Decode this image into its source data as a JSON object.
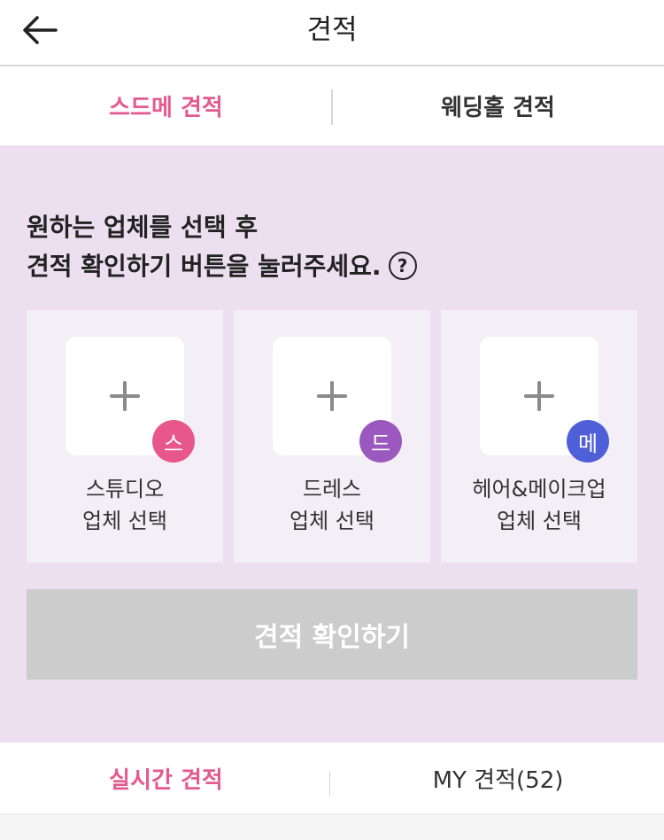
{
  "header": {
    "title": "견적",
    "back_icon": "arrow-left-icon"
  },
  "top_tabs": [
    {
      "label": "스드메 견적",
      "active": true
    },
    {
      "label": "웨딩홀 견적",
      "active": false
    }
  ],
  "instruction": {
    "line1": "원하는 업체를 선택 후",
    "line2": "견적 확인하기 버튼을 눌러주세요.",
    "help_symbol": "?"
  },
  "vendors": [
    {
      "badge": "스",
      "badge_color": "#e8578a",
      "name": "스튜디오",
      "action": "업체 선택",
      "icon": "plus-icon"
    },
    {
      "badge": "드",
      "badge_color": "#9b59c0",
      "name": "드레스",
      "action": "업체 선택",
      "icon": "plus-icon"
    },
    {
      "badge": "메",
      "badge_color": "#4f5fd8",
      "name": "헤어&메이크업",
      "action": "업체 선택",
      "icon": "plus-icon"
    }
  ],
  "confirm_button": {
    "label": "견적 확인하기",
    "enabled": false
  },
  "bottom_tabs": [
    {
      "label": "실시간 견적",
      "active": true
    },
    {
      "label": "MY 견적(52)",
      "active": false
    }
  ],
  "colors": {
    "accent": "#e35a8f",
    "background": "#ece0f0",
    "card": "#f4eef6",
    "disabled_button": "#cccccc"
  }
}
